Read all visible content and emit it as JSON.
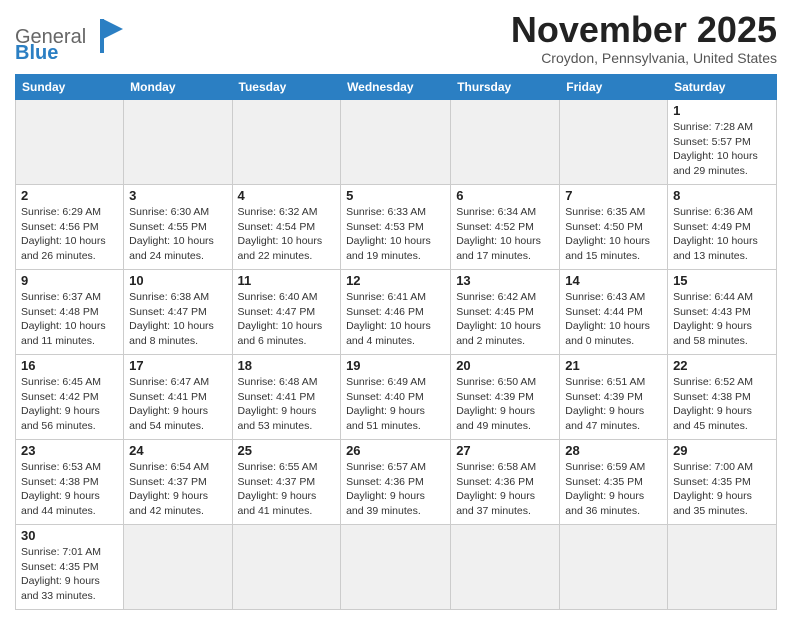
{
  "header": {
    "logo_general": "General",
    "logo_blue": "Blue",
    "month_title": "November 2025",
    "location": "Croydon, Pennsylvania, United States"
  },
  "days_of_week": [
    "Sunday",
    "Monday",
    "Tuesday",
    "Wednesday",
    "Thursday",
    "Friday",
    "Saturday"
  ],
  "weeks": [
    [
      {
        "day": "",
        "info": ""
      },
      {
        "day": "",
        "info": ""
      },
      {
        "day": "",
        "info": ""
      },
      {
        "day": "",
        "info": ""
      },
      {
        "day": "",
        "info": ""
      },
      {
        "day": "",
        "info": ""
      },
      {
        "day": "1",
        "info": "Sunrise: 7:28 AM\nSunset: 5:57 PM\nDaylight: 10 hours and 29 minutes."
      }
    ],
    [
      {
        "day": "2",
        "info": "Sunrise: 6:29 AM\nSunset: 4:56 PM\nDaylight: 10 hours and 26 minutes."
      },
      {
        "day": "3",
        "info": "Sunrise: 6:30 AM\nSunset: 4:55 PM\nDaylight: 10 hours and 24 minutes."
      },
      {
        "day": "4",
        "info": "Sunrise: 6:32 AM\nSunset: 4:54 PM\nDaylight: 10 hours and 22 minutes."
      },
      {
        "day": "5",
        "info": "Sunrise: 6:33 AM\nSunset: 4:53 PM\nDaylight: 10 hours and 19 minutes."
      },
      {
        "day": "6",
        "info": "Sunrise: 6:34 AM\nSunset: 4:52 PM\nDaylight: 10 hours and 17 minutes."
      },
      {
        "day": "7",
        "info": "Sunrise: 6:35 AM\nSunset: 4:50 PM\nDaylight: 10 hours and 15 minutes."
      },
      {
        "day": "8",
        "info": "Sunrise: 6:36 AM\nSunset: 4:49 PM\nDaylight: 10 hours and 13 minutes."
      }
    ],
    [
      {
        "day": "9",
        "info": "Sunrise: 6:37 AM\nSunset: 4:48 PM\nDaylight: 10 hours and 11 minutes."
      },
      {
        "day": "10",
        "info": "Sunrise: 6:38 AM\nSunset: 4:47 PM\nDaylight: 10 hours and 8 minutes."
      },
      {
        "day": "11",
        "info": "Sunrise: 6:40 AM\nSunset: 4:47 PM\nDaylight: 10 hours and 6 minutes."
      },
      {
        "day": "12",
        "info": "Sunrise: 6:41 AM\nSunset: 4:46 PM\nDaylight: 10 hours and 4 minutes."
      },
      {
        "day": "13",
        "info": "Sunrise: 6:42 AM\nSunset: 4:45 PM\nDaylight: 10 hours and 2 minutes."
      },
      {
        "day": "14",
        "info": "Sunrise: 6:43 AM\nSunset: 4:44 PM\nDaylight: 10 hours and 0 minutes."
      },
      {
        "day": "15",
        "info": "Sunrise: 6:44 AM\nSunset: 4:43 PM\nDaylight: 9 hours and 58 minutes."
      }
    ],
    [
      {
        "day": "16",
        "info": "Sunrise: 6:45 AM\nSunset: 4:42 PM\nDaylight: 9 hours and 56 minutes."
      },
      {
        "day": "17",
        "info": "Sunrise: 6:47 AM\nSunset: 4:41 PM\nDaylight: 9 hours and 54 minutes."
      },
      {
        "day": "18",
        "info": "Sunrise: 6:48 AM\nSunset: 4:41 PM\nDaylight: 9 hours and 53 minutes."
      },
      {
        "day": "19",
        "info": "Sunrise: 6:49 AM\nSunset: 4:40 PM\nDaylight: 9 hours and 51 minutes."
      },
      {
        "day": "20",
        "info": "Sunrise: 6:50 AM\nSunset: 4:39 PM\nDaylight: 9 hours and 49 minutes."
      },
      {
        "day": "21",
        "info": "Sunrise: 6:51 AM\nSunset: 4:39 PM\nDaylight: 9 hours and 47 minutes."
      },
      {
        "day": "22",
        "info": "Sunrise: 6:52 AM\nSunset: 4:38 PM\nDaylight: 9 hours and 45 minutes."
      }
    ],
    [
      {
        "day": "23",
        "info": "Sunrise: 6:53 AM\nSunset: 4:38 PM\nDaylight: 9 hours and 44 minutes."
      },
      {
        "day": "24",
        "info": "Sunrise: 6:54 AM\nSunset: 4:37 PM\nDaylight: 9 hours and 42 minutes."
      },
      {
        "day": "25",
        "info": "Sunrise: 6:55 AM\nSunset: 4:37 PM\nDaylight: 9 hours and 41 minutes."
      },
      {
        "day": "26",
        "info": "Sunrise: 6:57 AM\nSunset: 4:36 PM\nDaylight: 9 hours and 39 minutes."
      },
      {
        "day": "27",
        "info": "Sunrise: 6:58 AM\nSunset: 4:36 PM\nDaylight: 9 hours and 37 minutes."
      },
      {
        "day": "28",
        "info": "Sunrise: 6:59 AM\nSunset: 4:35 PM\nDaylight: 9 hours and 36 minutes."
      },
      {
        "day": "29",
        "info": "Sunrise: 7:00 AM\nSunset: 4:35 PM\nDaylight: 9 hours and 35 minutes."
      }
    ],
    [
      {
        "day": "30",
        "info": "Sunrise: 7:01 AM\nSunset: 4:35 PM\nDaylight: 9 hours and 33 minutes."
      },
      {
        "day": "",
        "info": ""
      },
      {
        "day": "",
        "info": ""
      },
      {
        "day": "",
        "info": ""
      },
      {
        "day": "",
        "info": ""
      },
      {
        "day": "",
        "info": ""
      },
      {
        "day": "",
        "info": ""
      }
    ]
  ]
}
